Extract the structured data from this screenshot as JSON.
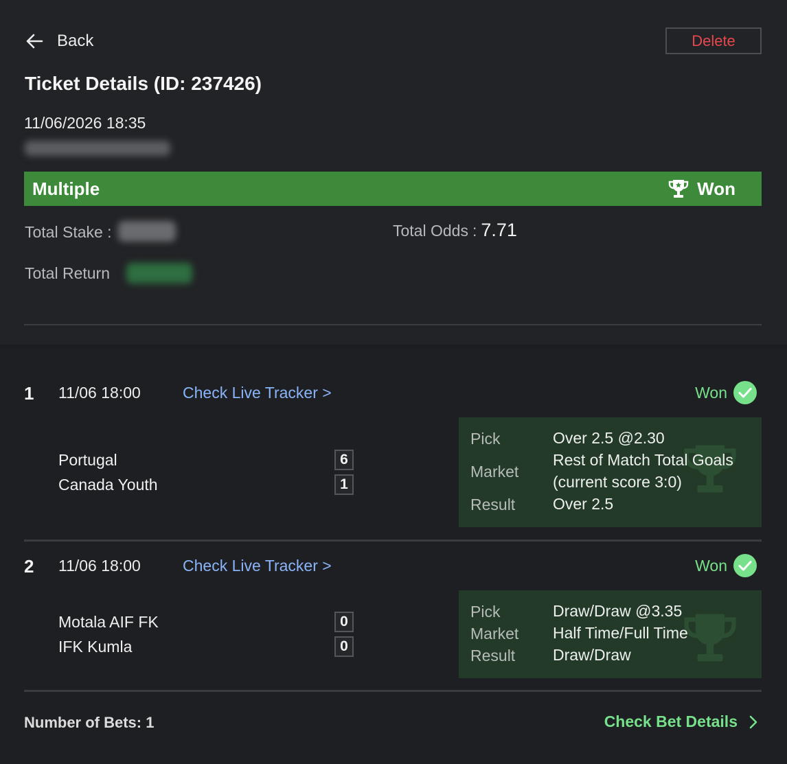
{
  "header": {
    "back_label": "Back",
    "delete_label": "Delete",
    "title": "Ticket Details (ID: 237426)",
    "datetime": "11/06/2026 18:35"
  },
  "banner": {
    "type": "Multiple",
    "status": "Won",
    "color": "#3c8a3a"
  },
  "summary": {
    "total_stake_label": "Total Stake :",
    "total_odds_label": "Total Odds",
    "total_odds_sep": ":",
    "total_odds_value": "7.71",
    "total_return_label": "Total Return"
  },
  "bets": [
    {
      "number": "1",
      "time": "11/06 18:00",
      "tracker_link": "Check Live Tracker >",
      "status": "Won",
      "home_team": "Portugal",
      "away_team": "Canada Youth",
      "home_score": "6",
      "away_score": "1",
      "pick_label": "Pick",
      "pick_value": "Over 2.5 @2.30",
      "market_label": "Market",
      "market_value": "Rest of Match Total Goals (current score 3:0)",
      "result_label": "Result",
      "result_value": "Over 2.5"
    },
    {
      "number": "2",
      "time": "11/06 18:00",
      "tracker_link": "Check Live Tracker >",
      "status": "Won",
      "home_team": "Motala AIF FK",
      "away_team": "IFK Kumla",
      "home_score": "0",
      "away_score": "0",
      "pick_label": "Pick",
      "pick_value": "Draw/Draw @3.35",
      "market_label": "Market",
      "market_value": "Half Time/Full Time",
      "result_label": "Result",
      "result_value": "Draw/Draw"
    }
  ],
  "footer": {
    "count_label": "Number of Bets: 1",
    "details_link": "Check Bet Details"
  },
  "colors": {
    "won_green": "#77e08a",
    "delete_red": "#e5484d",
    "link_blue": "#8ab4f8"
  },
  "icons": [
    "arrow-left-icon",
    "trophy-icon",
    "check-circle-icon",
    "chevron-right-icon"
  ]
}
